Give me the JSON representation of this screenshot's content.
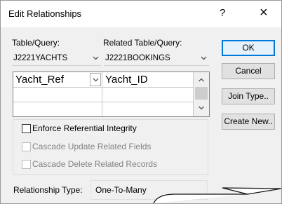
{
  "window": {
    "title": "Edit Relationships",
    "help": "?",
    "close": "×"
  },
  "labels": {
    "table_query": "Table/Query:",
    "related_table_query": "Related Table/Query:"
  },
  "combos": {
    "table": {
      "value": "J2221YACHTS"
    },
    "related": {
      "value": "J2221BOOKINGS"
    }
  },
  "grid": {
    "rows": [
      {
        "left": "Yacht_Ref",
        "right": "Yacht_ID"
      },
      {
        "left": "",
        "right": ""
      },
      {
        "left": "",
        "right": ""
      }
    ]
  },
  "buttons": {
    "ok": "OK",
    "cancel": "Cancel",
    "join_type": "Join Type..",
    "create_new": "Create New.."
  },
  "options": {
    "enforce": {
      "label": "Enforce Referential Integrity",
      "checked": false,
      "enabled": true
    },
    "cascade_update": {
      "label": "Cascade Update Related Fields",
      "checked": false,
      "enabled": false
    },
    "cascade_delete": {
      "label": "Cascade Delete Related Records",
      "checked": false,
      "enabled": false
    }
  },
  "relationship": {
    "label": "Relationship Type:",
    "value": "One-To-Many"
  },
  "icons": [
    "help-icon",
    "close-icon",
    "chevron-down-icon",
    "scroll-up-icon",
    "scroll-down-icon"
  ],
  "colors": {
    "default_button_border": "#0078d7",
    "title_bg": "#ffffff",
    "dialog_bg": "#f0f0f0"
  }
}
